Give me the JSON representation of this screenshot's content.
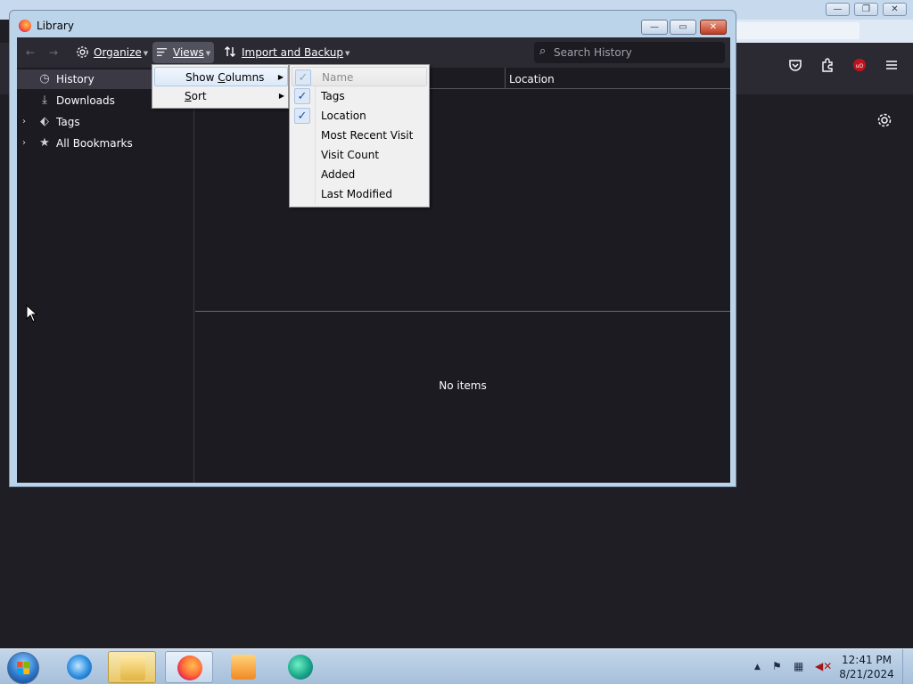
{
  "background_browser": {
    "toolbar_icons": [
      "pocket-icon",
      "extensions-icon",
      "ublock-icon",
      "menu-icon"
    ],
    "settings_icon": "gear-icon",
    "window_buttons": [
      "minimize",
      "restore",
      "close"
    ]
  },
  "library": {
    "title": "Library",
    "toolbar": {
      "back_glyph": "←",
      "forward_glyph": "→",
      "organize_label": "Organize",
      "views_label": "Views",
      "import_label": "Import and Backup",
      "search_placeholder": "Search History"
    },
    "tree": [
      {
        "label": "History",
        "icon": "clock-icon",
        "glyph": "◷",
        "selected": true,
        "expandable": false
      },
      {
        "label": "Downloads",
        "icon": "download-icon",
        "glyph": "⤓",
        "selected": false,
        "expandable": false
      },
      {
        "label": "Tags",
        "icon": "tag-icon",
        "glyph": "⬖",
        "selected": false,
        "expandable": true
      },
      {
        "label": "All Bookmarks",
        "icon": "star-icon",
        "glyph": "★",
        "selected": false,
        "expandable": true
      }
    ],
    "columns": {
      "location": "Location"
    },
    "details": {
      "empty_text": "No items"
    }
  },
  "views_menu": {
    "items": [
      {
        "label_pre": "Show ",
        "label_key": "C",
        "label_post": "olumns",
        "has_submenu": true,
        "highlighted": true
      },
      {
        "label_pre": "",
        "label_key": "S",
        "label_post": "ort",
        "has_submenu": true,
        "highlighted": false
      }
    ]
  },
  "columns_menu": {
    "items": [
      {
        "label": "Name",
        "checked": true,
        "disabled": true,
        "highlighted": true
      },
      {
        "label": "Tags",
        "checked": true,
        "disabled": false,
        "highlighted": false
      },
      {
        "label": "Location",
        "checked": true,
        "disabled": false,
        "highlighted": false
      },
      {
        "label": "Most Recent Visit",
        "checked": false,
        "disabled": false,
        "highlighted": false
      },
      {
        "label": "Visit Count",
        "checked": false,
        "disabled": false,
        "highlighted": false
      },
      {
        "label": "Added",
        "checked": false,
        "disabled": false,
        "highlighted": false
      },
      {
        "label": "Last Modified",
        "checked": false,
        "disabled": false,
        "highlighted": false
      }
    ]
  },
  "taskbar": {
    "apps": [
      "internet-explorer",
      "file-explorer",
      "firefox",
      "media-player",
      "edge"
    ],
    "clock_time": "12:41 PM",
    "clock_date": "8/21/2024"
  }
}
